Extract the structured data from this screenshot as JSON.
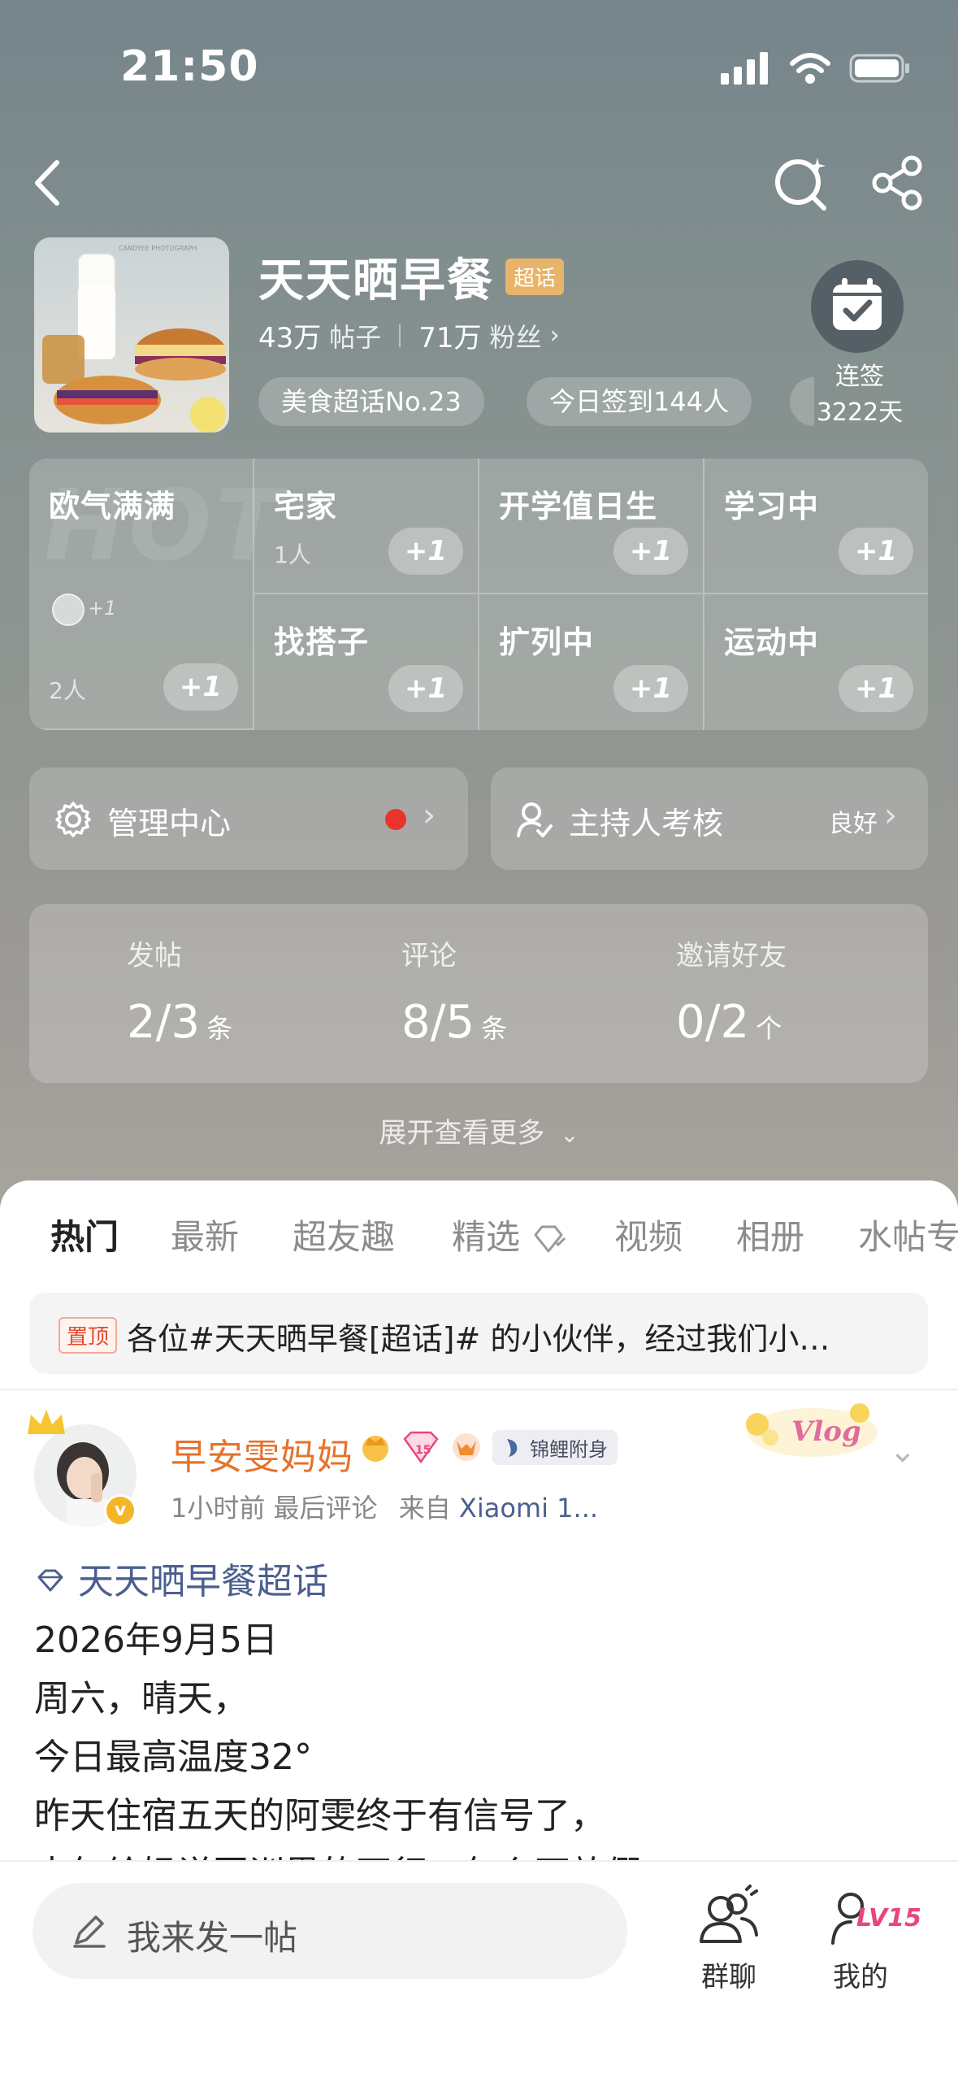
{
  "status_bar": {
    "time": "21:50"
  },
  "topic": {
    "title": "天天晒早餐",
    "badge": "超话",
    "posts_count": "43万",
    "posts_label": "帖子",
    "fans_count": "71万",
    "fans_label": "粉丝",
    "cover_caption": "CANDYEE PHOTOGRAPH",
    "pills": [
      "美食超话No.23",
      "今日签到144人"
    ],
    "checkin": {
      "label": "连签",
      "days": "3222天"
    }
  },
  "groups": {
    "watermark": "HOT",
    "items": [
      {
        "name": "欧气满满",
        "count": "2人",
        "plus": "+1",
        "mini_plus": "+1"
      },
      {
        "name": "宅家",
        "count": "1人",
        "plus": "+1"
      },
      {
        "name": "开学值日生",
        "count": "",
        "plus": "+1"
      },
      {
        "name": "学习中",
        "count": "",
        "plus": "+1"
      },
      {
        "name": "找搭子",
        "count": "",
        "plus": "+1"
      },
      {
        "name": "扩列中",
        "count": "",
        "plus": "+1"
      },
      {
        "name": "运动中",
        "count": "",
        "plus": "+1"
      }
    ]
  },
  "management": {
    "admin_center": "管理中心",
    "host_review": "主持人考核",
    "host_status": "良好"
  },
  "tasks": [
    {
      "label": "发帖",
      "value": "2/3",
      "unit": "条"
    },
    {
      "label": "评论",
      "value": "8/5",
      "unit": "条"
    },
    {
      "label": "邀请好友",
      "value": "0/2",
      "unit": "个"
    }
  ],
  "expand_label": "展开查看更多",
  "tabs": [
    "热门",
    "最新",
    "超友趣",
    "精选",
    "视频",
    "相册",
    "水帖专"
  ],
  "pinned": {
    "badge": "置顶",
    "text": "各位#天天晒早餐[超话]# 的小伙伴，经过我们小…"
  },
  "post": {
    "user": "早安雯妈妈",
    "level_badge": "15",
    "koi_badge": "锦鲤附身",
    "time": "1小时前",
    "last_comment": "最后评论",
    "source_prefix": "来自",
    "source": "Xiaomi 1...",
    "topic_link": "天天晒早餐超话",
    "lines": [
      "2026年9月5日",
      "周六，晴天，",
      "今日最高温度32°",
      "昨天住宿五天的阿雯终于有信号了，",
      "中午给妈说因训界的不行，怎么不放假"
    ],
    "sticker_text": "Vlog"
  },
  "bottom_bar": {
    "post_placeholder": "我来发一帖",
    "group_chat": "群聊",
    "mine": "我的",
    "level": "LV15"
  },
  "colors": {
    "accent_orange": "#f08b37",
    "username": "#e6722c",
    "link_blue": "#4b5f8f",
    "red_dot": "#e8352c"
  }
}
